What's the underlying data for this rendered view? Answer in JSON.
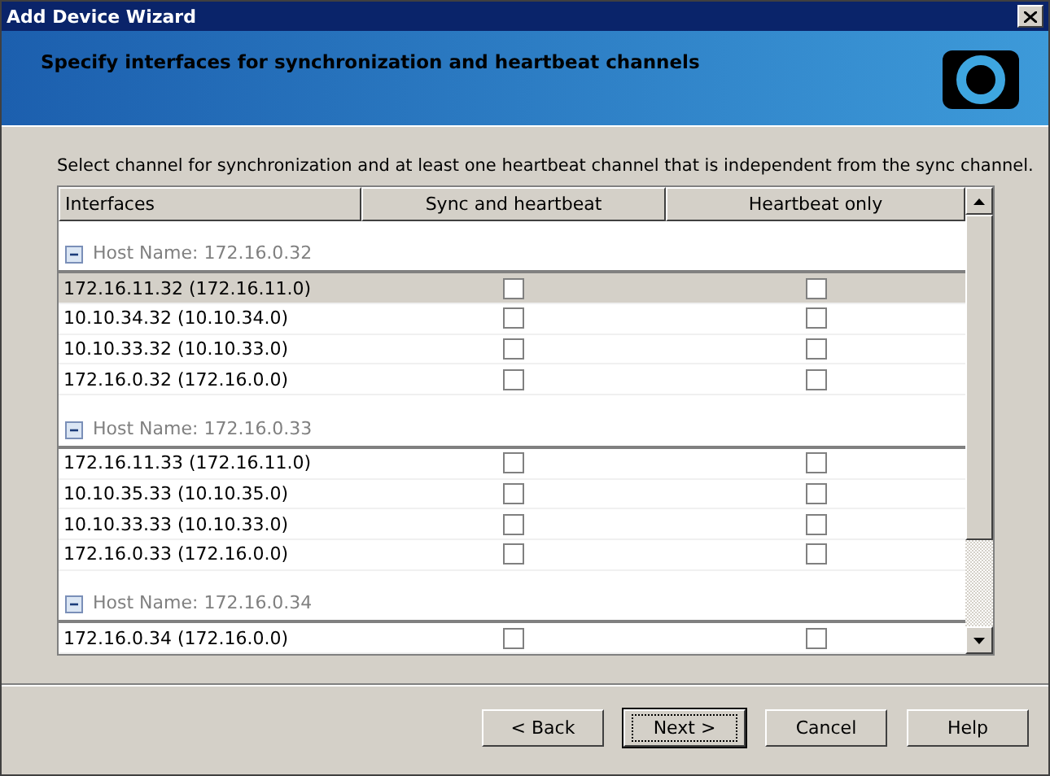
{
  "window": {
    "title": "Add Device Wizard"
  },
  "header": {
    "title": "Specify interfaces for synchronization and heartbeat channels"
  },
  "instruction": "Select channel for synchronization and at least one heartbeat channel that is independent from the sync channel.",
  "table": {
    "columns": [
      "Interfaces",
      "Sync and heartbeat",
      "Heartbeat only"
    ],
    "groups": [
      {
        "host": "Host Name: 172.16.0.32",
        "expanded": true,
        "rows": [
          {
            "interface": "172.16.11.32 (172.16.11.0)",
            "selected": true,
            "sync": false,
            "heartbeat": false
          },
          {
            "interface": "10.10.34.32 (10.10.34.0)",
            "selected": false,
            "sync": false,
            "heartbeat": false
          },
          {
            "interface": "10.10.33.32 (10.10.33.0)",
            "selected": false,
            "sync": false,
            "heartbeat": false
          },
          {
            "interface": "172.16.0.32 (172.16.0.0)",
            "selected": false,
            "sync": false,
            "heartbeat": false
          }
        ]
      },
      {
        "host": "Host Name: 172.16.0.33",
        "expanded": true,
        "rows": [
          {
            "interface": "172.16.11.33 (172.16.11.0)",
            "selected": false,
            "sync": false,
            "heartbeat": false
          },
          {
            "interface": "10.10.35.33 (10.10.35.0)",
            "selected": false,
            "sync": false,
            "heartbeat": false
          },
          {
            "interface": "10.10.33.33 (10.10.33.0)",
            "selected": false,
            "sync": false,
            "heartbeat": false
          },
          {
            "interface": "172.16.0.33 (172.16.0.0)",
            "selected": false,
            "sync": false,
            "heartbeat": false
          }
        ]
      },
      {
        "host": "Host Name: 172.16.0.34",
        "expanded": true,
        "rows": [
          {
            "interface": "172.16.0.34 (172.16.0.0)",
            "selected": false,
            "sync": false,
            "heartbeat": false
          }
        ]
      }
    ]
  },
  "buttons": [
    {
      "label": "< Back",
      "default": false
    },
    {
      "label": "Next >",
      "default": true
    },
    {
      "label": "Cancel",
      "default": false
    },
    {
      "label": "Help",
      "default": false
    }
  ]
}
